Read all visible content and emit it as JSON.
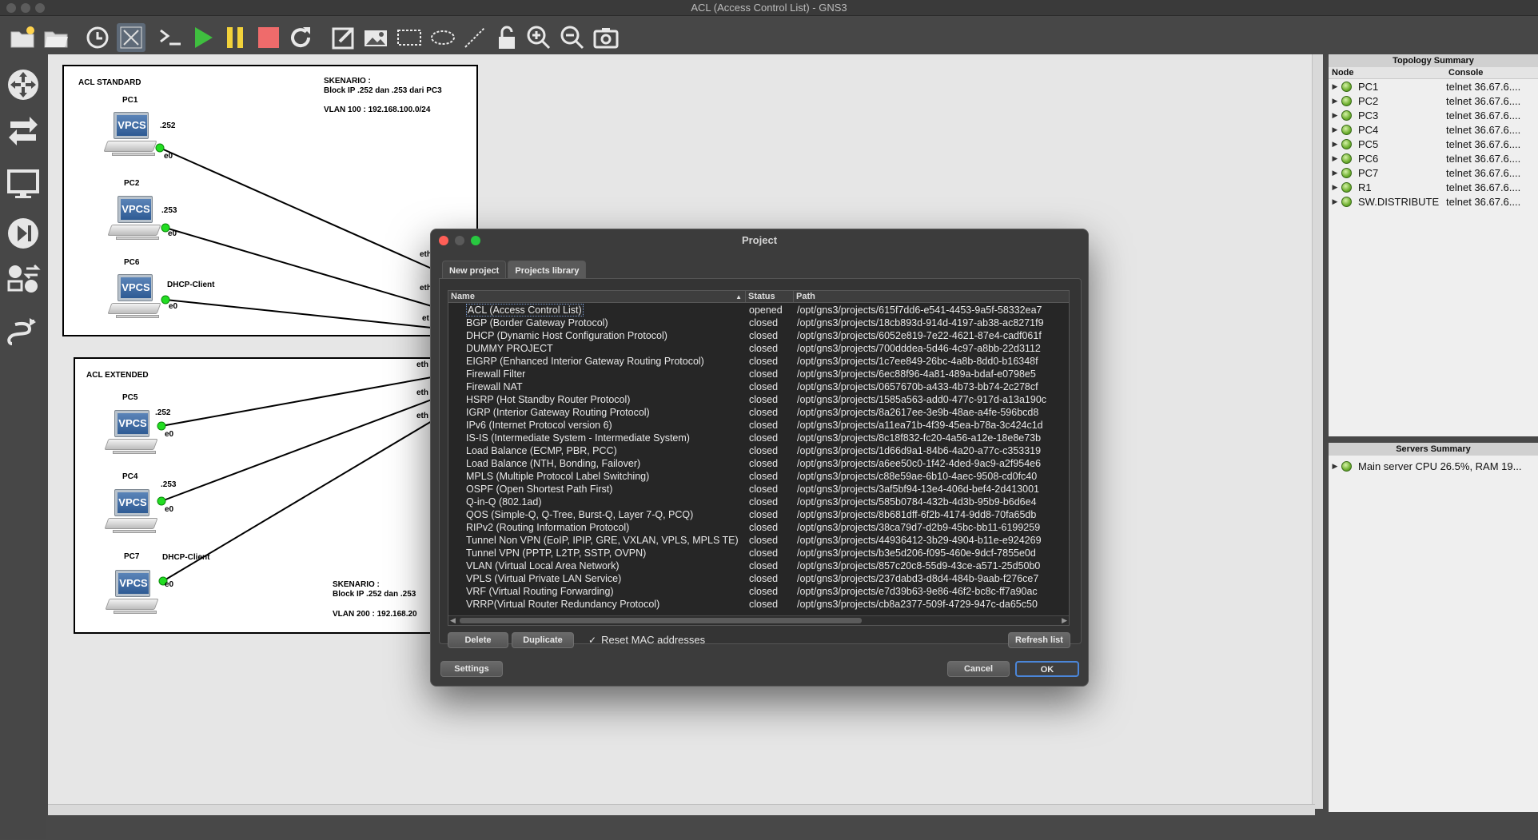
{
  "app": {
    "title": "ACL (Access Control List) - GNS3"
  },
  "toolbar": {
    "icons": [
      "open-folder-new",
      "open-folder",
      "clock",
      "snapshot",
      "console",
      "start",
      "pause",
      "stop",
      "reload",
      "edit-note",
      "image",
      "rectangle",
      "ellipse",
      "line",
      "unlock",
      "zoom-in",
      "zoom-out",
      "screenshot"
    ]
  },
  "left_tools": {
    "icons": [
      "router",
      "switch",
      "end-device",
      "security-device",
      "all-devices",
      "add-link"
    ]
  },
  "topology": {
    "acl_standard": {
      "title": "ACL STANDARD",
      "scenario_title": "SKENARIO :",
      "scenario_text": "Block IP .252 dan .253 dari PC3",
      "vlan": "VLAN 100 : 192.168.100.0/24",
      "nodes": [
        {
          "name": "PC1",
          "ip": ".252",
          "port": "e0"
        },
        {
          "name": "PC2",
          "ip": ".253",
          "port": "e0"
        },
        {
          "name": "PC6",
          "ip": "DHCP-Client",
          "port": "e0"
        }
      ]
    },
    "acl_extended": {
      "title": "ACL EXTENDED",
      "scenario_title": "SKENARIO :",
      "scenario_text": "Block IP .252 dan .253",
      "vlan": "VLAN 200 : 192.168.20",
      "nodes": [
        {
          "name": "PC5",
          "ip": ".252",
          "port": "e0"
        },
        {
          "name": "PC4",
          "ip": ".253",
          "port": "e0"
        },
        {
          "name": "PC7",
          "ip": "DHCP-Client",
          "port": "e0"
        }
      ]
    },
    "vpcs_label": "VPCS",
    "eth_labels": [
      "eth",
      "eth",
      "et",
      "eth",
      "eth",
      "eth"
    ]
  },
  "topology_summary": {
    "title": "Topology Summary",
    "col_node": "Node",
    "col_console": "Console",
    "rows": [
      {
        "node": "PC1",
        "console": "telnet 36.67.6...."
      },
      {
        "node": "PC2",
        "console": "telnet 36.67.6...."
      },
      {
        "node": "PC3",
        "console": "telnet 36.67.6...."
      },
      {
        "node": "PC4",
        "console": "telnet 36.67.6...."
      },
      {
        "node": "PC5",
        "console": "telnet 36.67.6...."
      },
      {
        "node": "PC6",
        "console": "telnet 36.67.6...."
      },
      {
        "node": "PC7",
        "console": "telnet 36.67.6...."
      },
      {
        "node": "R1",
        "console": "telnet 36.67.6...."
      },
      {
        "node": "SW.DISTRIBUTE",
        "console": "telnet 36.67.6...."
      }
    ]
  },
  "servers_summary": {
    "title": "Servers Summary",
    "rows": [
      {
        "label": "Main server CPU 26.5%, RAM 19..."
      }
    ]
  },
  "dialog": {
    "title": "Project",
    "tabs": [
      "New project",
      "Projects library"
    ],
    "active_tab": 1,
    "columns": [
      "Name",
      "Status",
      "Path"
    ],
    "projects": [
      {
        "name": "ACL (Access Control List)",
        "status": "opened",
        "path": "/opt/gns3/projects/615f7dd6-e541-4453-9a5f-58332ea7"
      },
      {
        "name": "BGP (Border Gateway Protocol)",
        "status": "closed",
        "path": "/opt/gns3/projects/18cb893d-914d-4197-ab38-ac8271f9"
      },
      {
        "name": "DHCP (Dynamic Host Configuration Protocol)",
        "status": "closed",
        "path": "/opt/gns3/projects/6052e819-7e22-4621-87e4-cadf061f"
      },
      {
        "name": "DUMMY PROJECT",
        "status": "closed",
        "path": "/opt/gns3/projects/700dddea-5d46-4c97-a8bb-22d3112"
      },
      {
        "name": "EIGRP (Enhanced Interior Gateway Routing Protocol)",
        "status": "closed",
        "path": "/opt/gns3/projects/1c7ee849-26bc-4a8b-8dd0-b16348f"
      },
      {
        "name": "Firewall Filter",
        "status": "closed",
        "path": "/opt/gns3/projects/6ec88f96-4a81-489a-bdaf-e0798e5"
      },
      {
        "name": "Firewall NAT",
        "status": "closed",
        "path": "/opt/gns3/projects/0657670b-a433-4b73-bb74-2c278cf"
      },
      {
        "name": "HSRP (Hot Standby Router Protocol)",
        "status": "closed",
        "path": "/opt/gns3/projects/1585a563-add0-477c-917d-a13a190c"
      },
      {
        "name": "IGRP (Interior Gateway Routing Protocol)",
        "status": "closed",
        "path": "/opt/gns3/projects/8a2617ee-3e9b-48ae-a4fe-596bcd8"
      },
      {
        "name": "IPv6 (Internet Protocol version 6)",
        "status": "closed",
        "path": "/opt/gns3/projects/a11ea71b-4f39-45ea-b78a-3c424c1d"
      },
      {
        "name": "IS-IS (Intermediate System - Intermediate System)",
        "status": "closed",
        "path": "/opt/gns3/projects/8c18f832-fc20-4a56-a12e-18e8e73b"
      },
      {
        "name": "Load Balance (ECMP, PBR, PCC)",
        "status": "closed",
        "path": "/opt/gns3/projects/1d66d9a1-84b6-4a20-a77c-c353319"
      },
      {
        "name": "Load Balance (NTH, Bonding, Failover)",
        "status": "closed",
        "path": "/opt/gns3/projects/a6ee50c0-1f42-4ded-9ac9-a2f954e6"
      },
      {
        "name": "MPLS (Multiple Protocol Label Switching)",
        "status": "closed",
        "path": "/opt/gns3/projects/c88e59ae-6b10-4aec-9508-cd0fc40"
      },
      {
        "name": "OSPF (Open Shortest Path First)",
        "status": "closed",
        "path": "/opt/gns3/projects/3af5bf94-13e4-406d-bef4-2d413001"
      },
      {
        "name": "Q-in-Q (802.1ad)",
        "status": "closed",
        "path": "/opt/gns3/projects/585b0784-432b-4d3b-95b9-b6d6e4"
      },
      {
        "name": "QOS (Simple-Q, Q-Tree, Burst-Q, Layer 7-Q, PCQ)",
        "status": "closed",
        "path": "/opt/gns3/projects/8b681dff-6f2b-4174-9dd8-70fa65db"
      },
      {
        "name": "RIPv2 (Routing Information Protocol)",
        "status": "closed",
        "path": "/opt/gns3/projects/38ca79d7-d2b9-45bc-bb11-6199259"
      },
      {
        "name": "Tunnel Non VPN (EoIP, IPIP, GRE, VXLAN, VPLS, MPLS TE)",
        "status": "closed",
        "path": "/opt/gns3/projects/44936412-3b29-4904-b11e-e924269"
      },
      {
        "name": "Tunnel VPN (PPTP, L2TP, SSTP, OVPN)",
        "status": "closed",
        "path": "/opt/gns3/projects/b3e5d206-f095-460e-9dcf-7855e0d"
      },
      {
        "name": "VLAN (Virtual Local Area Network)",
        "status": "closed",
        "path": "/opt/gns3/projects/857c20c8-55d9-43ce-a571-25d50b0"
      },
      {
        "name": "VPLS (Virtual Private LAN Service)",
        "status": "closed",
        "path": "/opt/gns3/projects/237dabd3-d8d4-484b-9aab-f276ce7"
      },
      {
        "name": "VRF (Virtual Routing Forwarding)",
        "status": "closed",
        "path": "/opt/gns3/projects/e7d39b63-9e86-46f2-bc8c-ff7a90ac"
      },
      {
        "name": "VRRP(Virtual Router Redundancy Protocol)",
        "status": "closed",
        "path": "/opt/gns3/projects/cb8a2377-509f-4729-947c-da65c50"
      }
    ],
    "buttons": {
      "delete": "Delete",
      "duplicate": "Duplicate",
      "reset_mac": "Reset MAC addresses",
      "reset_mac_checked": "✓",
      "refresh": "Refresh list",
      "settings": "Settings",
      "cancel": "Cancel",
      "ok": "OK"
    }
  },
  "colors": {
    "link_dot": "#22dd22",
    "accent": "#4b86d9"
  }
}
